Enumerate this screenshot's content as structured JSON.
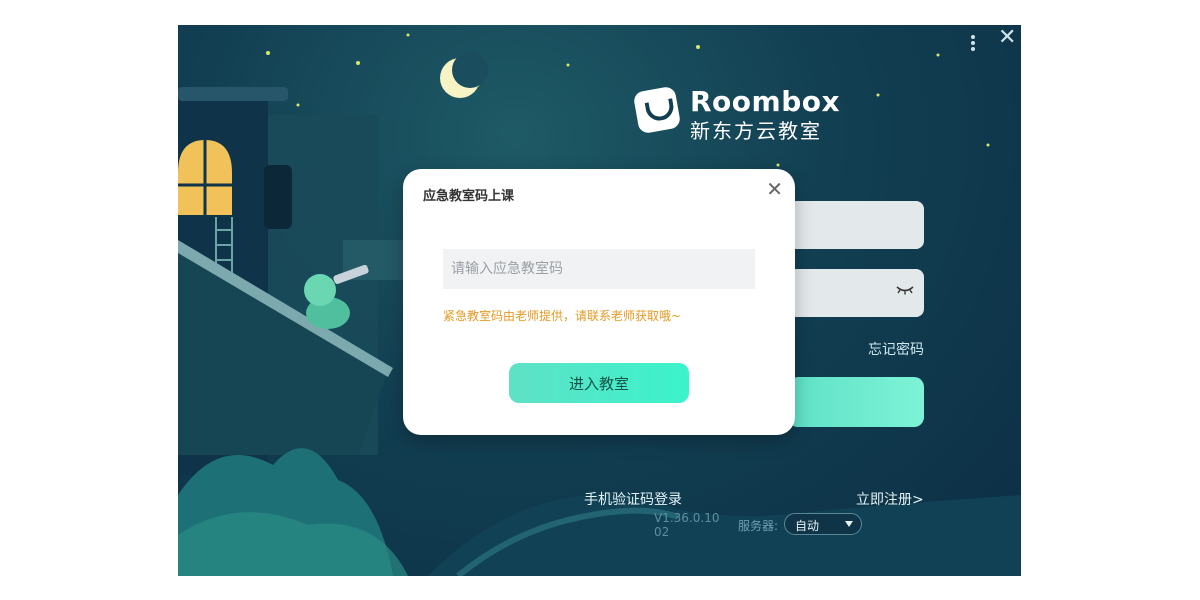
{
  "app": {
    "brand_en": "Roombox",
    "brand_cn": "新东方云教室",
    "colors": {
      "background": "#123f52",
      "accent": "#5fe1c6",
      "hint": "#e39a23"
    }
  },
  "window_controls": {
    "more_icon": "kebab-icon",
    "close_icon": "close-icon",
    "close_glyph": "✕"
  },
  "login": {
    "forgot_label": "忘记密码",
    "phone_login_label": "手机验证码登录",
    "register_label": "立即注册>",
    "version": "V1.36.0.1002",
    "server_label": "服务器:",
    "server_value": "自动"
  },
  "dialog": {
    "title": "应急教室码上课",
    "close_glyph": "✕",
    "input_placeholder": "请输入应急教室码",
    "input_value": "",
    "hint": "紧急教室码由老师提供，请联系老师获取哦~",
    "enter_label": "进入教室"
  }
}
